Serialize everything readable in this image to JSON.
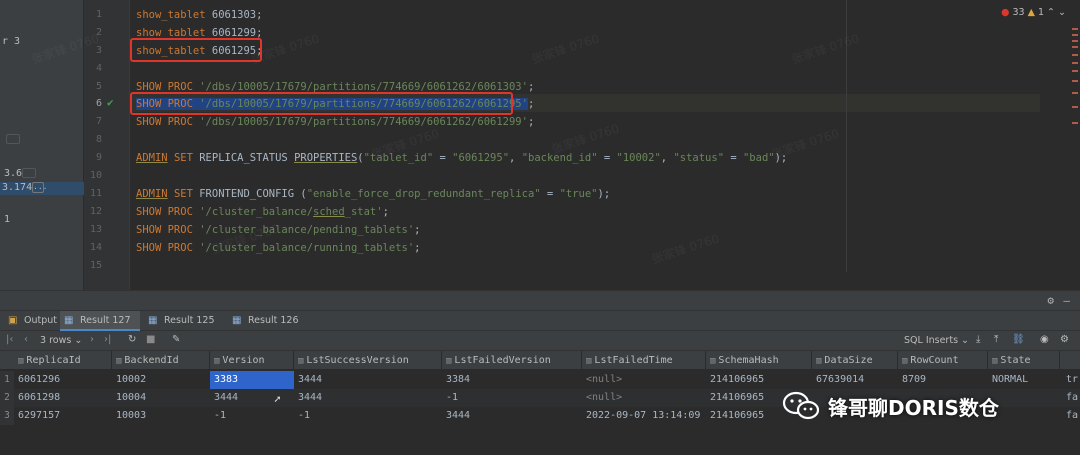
{
  "sidebar": {
    "items": [
      {
        "label": "r 3"
      },
      {
        "label": "3.6"
      },
      {
        "label": "3.174"
      },
      {
        "label": "..."
      },
      {
        "label": "1"
      }
    ]
  },
  "editor": {
    "inspection": {
      "errors": "33",
      "warnings": "1"
    },
    "line_numbers": [
      "1",
      "2",
      "3",
      "4",
      "5",
      "6",
      "7",
      "8",
      "9",
      "10",
      "11",
      "12",
      "13",
      "14",
      "15"
    ],
    "current_line": "6",
    "watermark": "张家锋 0760",
    "lines": {
      "l1": {
        "kw": "show_tablet",
        "val": " 6061303;"
      },
      "l2": {
        "kw": "show_tablet",
        "val": " 6061299;"
      },
      "l3": {
        "kw": "show_tablet",
        "val": " 6061295;"
      },
      "l5": {
        "kw": "SHOW PROC",
        "str": "'/dbs/10005/17679/partitions/774669/6061262/6061303'",
        "end": ";"
      },
      "l6": {
        "kw": "SHOW PROC",
        "str": "'/dbs/10005/17679/partitions/774669/6061262/6061295'",
        "end": ";"
      },
      "l7": {
        "kw": "SHOW PROC",
        "str": "'/dbs/10005/17679/partitions/774669/6061262/6061299'",
        "end": ";"
      },
      "l9": {
        "kw1": "ADMIN",
        "kw2": "SET",
        "id1": " REPLICA_STATUS ",
        "id2": "PROPERTIES",
        "rest": "(",
        "s1": "\"tablet_id\"",
        "eq1": " = ",
        "s2": "\"6061295\"",
        "c1": ", ",
        "s3": "\"backend_id\"",
        "eq2": " = ",
        "s4": "\"10002\"",
        "c2": ", ",
        "s5": "\"status\"",
        "eq3": " = ",
        "s6": "\"bad\"",
        "end": ");"
      },
      "l11": {
        "kw1": "ADMIN",
        "kw2": "SET",
        "id1": " FRONTEND_CONFIG ",
        "rest": "(",
        "s1": "\"enable_force_drop_redundant_replica\"",
        "eq": " = ",
        "s2": "\"true\"",
        "end": ");"
      },
      "l12": {
        "kw": "SHOW PROC",
        "s_a": "'/cluster_balance/",
        "s_b": "sched",
        "s_c": "_stat'",
        "end": ";"
      },
      "l13": {
        "kw": "SHOW PROC",
        "str": "'/cluster_balance/pending_tablets'",
        "end": ";"
      },
      "l14": {
        "kw": "SHOW PROC",
        "str": "'/cluster_balance/running_tablets'",
        "end": ";"
      }
    }
  },
  "bottom_panel": {
    "tabs": [
      {
        "label": "Output"
      },
      {
        "label": "Result 127"
      },
      {
        "label": "Result 125"
      },
      {
        "label": "Result 126"
      }
    ],
    "rows_selector": "3 rows",
    "sql_mode": "SQL Inserts",
    "table": {
      "columns": [
        "ReplicaId",
        "BackendId",
        "Version",
        "LstSuccessVersion",
        "LstFailedVersion",
        "LstFailedTime",
        "SchemaHash",
        "DataSize",
        "RowCount",
        "State"
      ],
      "rows": [
        {
          "n": "1",
          "cells": [
            "6061296",
            "10002",
            "3383",
            "3444",
            "3384",
            "<null>",
            "214106965",
            "67639014",
            "8709",
            "NORMAL",
            "tr"
          ]
        },
        {
          "n": "2",
          "cells": [
            "6061298",
            "10004",
            "3444",
            "3444",
            "-1",
            "<null>",
            "214106965",
            "67___",
            "___",
            "___",
            "fa"
          ]
        },
        {
          "n": "3",
          "cells": [
            "6297157",
            "10003",
            "-1",
            "-1",
            "3444",
            "2022-09-07 13:14:09",
            "214106965",
            "",
            "1",
            "CLONE",
            "fa"
          ]
        }
      ]
    }
  },
  "wechat": {
    "title": "锋哥聊DORIS数仓"
  }
}
